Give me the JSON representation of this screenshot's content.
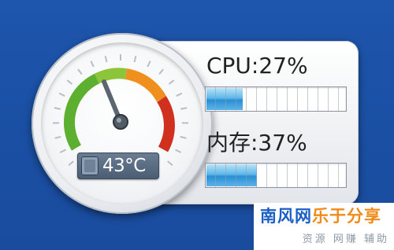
{
  "gadget": {
    "gauge": {
      "temperature": "43°C",
      "zones": [
        "green",
        "orange",
        "red"
      ]
    },
    "cpu": {
      "label": "CPU:27%",
      "usage_percent": 27
    },
    "memory": {
      "label": "内存:37%",
      "usage_percent": 37
    }
  },
  "watermark": {
    "brand": "南风网",
    "slogan": "乐于分享",
    "subtitle": "资源 网赚 辅助"
  },
  "colors": {
    "desktop": "#1d55ab",
    "bar_fill": "#2b8fd3",
    "brand": "#1c5fc4",
    "slogan": "#f08a1a"
  }
}
